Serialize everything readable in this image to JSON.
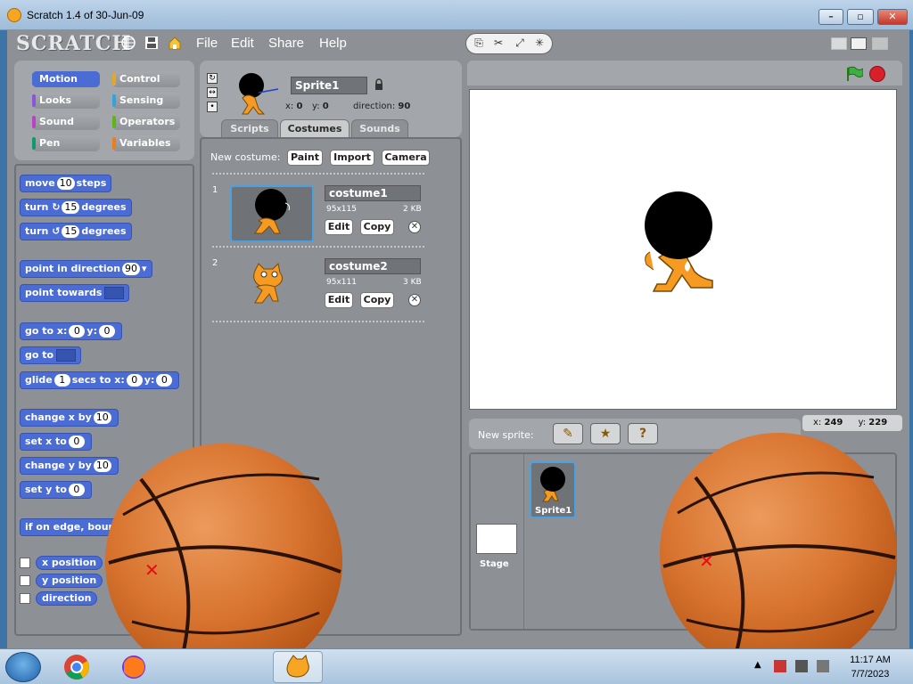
{
  "window": {
    "title": "Scratch 1.4 of 30-Jun-09"
  },
  "menubar": {
    "logo": "SCRATCH",
    "items": [
      "File",
      "Edit",
      "Share",
      "Help"
    ]
  },
  "categories": [
    {
      "label": "Motion",
      "color": "#4a6cd4",
      "selected": true
    },
    {
      "label": "Control",
      "color": "#e6a822"
    },
    {
      "label": "Looks",
      "color": "#8a55d7"
    },
    {
      "label": "Sensing",
      "color": "#2ca5e2"
    },
    {
      "label": "Sound",
      "color": "#bb42c3"
    },
    {
      "label": "Operators",
      "color": "#5cb712"
    },
    {
      "label": "Pen",
      "color": "#0e9a6c"
    },
    {
      "label": "Variables",
      "color": "#ee7d16"
    }
  ],
  "blocks": {
    "move": {
      "a": "move",
      "v": "10",
      "b": "steps"
    },
    "turn_right": {
      "a": "turn",
      "v": "15",
      "b": "degrees"
    },
    "turn_left": {
      "a": "turn",
      "v": "15",
      "b": "degrees"
    },
    "point_dir": {
      "a": "point in direction",
      "v": "90"
    },
    "point_towards": {
      "a": "point towards"
    },
    "goto_xy": {
      "a": "go to x:",
      "x": "0",
      "b": "y:",
      "y": "0"
    },
    "goto": {
      "a": "go to"
    },
    "glide": {
      "a": "glide",
      "s": "1",
      "b": "secs to x:",
      "x": "0",
      "c": "y:",
      "y": "0"
    },
    "change_x": {
      "a": "change x by",
      "v": "10"
    },
    "set_x": {
      "a": "set x to",
      "v": "0"
    },
    "change_y": {
      "a": "change y by",
      "v": "10"
    },
    "set_y": {
      "a": "set y to",
      "v": "0"
    },
    "bounce": {
      "a": "if on edge, bounce"
    }
  },
  "reporters": [
    "x position",
    "y position",
    "direction"
  ],
  "sprite": {
    "name": "Sprite1",
    "x_label": "x:",
    "x": "0",
    "y_label": "y:",
    "y": "0",
    "dir_label": "direction:",
    "dir": "90"
  },
  "tabs": [
    {
      "label": "Scripts"
    },
    {
      "label": "Costumes",
      "active": true
    },
    {
      "label": "Sounds"
    }
  ],
  "costumes": {
    "new_label": "New costume:",
    "buttons": [
      "Paint",
      "Import",
      "Camera"
    ],
    "items": [
      {
        "num": "1",
        "name": "costume1",
        "size": "95x115",
        "kb": "2 KB",
        "edit": "Edit",
        "copy": "Copy"
      },
      {
        "num": "2",
        "name": "costume2",
        "size": "95x111",
        "kb": "3 KB",
        "edit": "Edit",
        "copy": "Copy"
      }
    ]
  },
  "stage_panel": {
    "new_sprite_label": "New sprite:",
    "mouse_x_label": "x:",
    "mouse_x": "249",
    "mouse_y_label": "y:",
    "mouse_y": "229",
    "stage_label": "Stage",
    "sprite_label": "Sprite1"
  },
  "taskbar": {
    "time": "11:17 AM",
    "date": "7/7/2023"
  }
}
